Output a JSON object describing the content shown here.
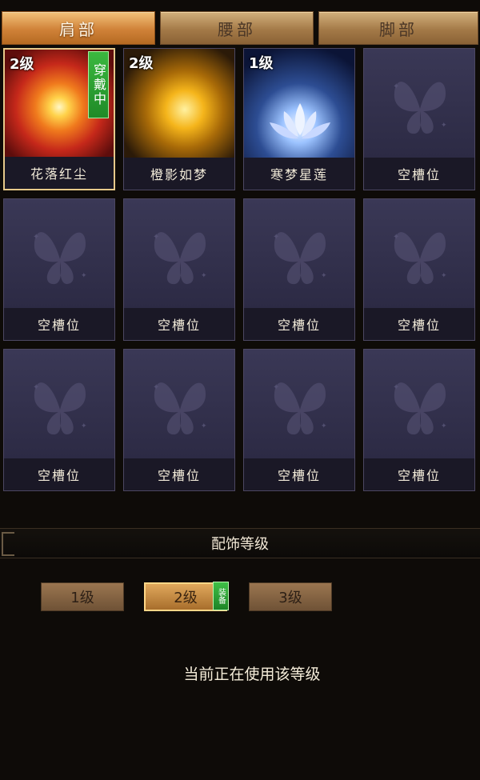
{
  "tabs": [
    {
      "label": "肩部",
      "active": true
    },
    {
      "label": "腰部",
      "active": false
    },
    {
      "label": "脚部",
      "active": false
    }
  ],
  "slots": [
    {
      "name": "花落红尘",
      "level": "2级",
      "badge": "穿戴中",
      "art": "fire",
      "selected": true
    },
    {
      "name": "橙影如梦",
      "level": "2级",
      "badge": "",
      "art": "gold",
      "selected": false
    },
    {
      "name": "寒梦星莲",
      "level": "1级",
      "badge": "",
      "art": "lotus",
      "selected": false
    },
    {
      "name": "空槽位",
      "level": "",
      "badge": "",
      "art": "empty",
      "selected": false
    },
    {
      "name": "空槽位",
      "level": "",
      "badge": "",
      "art": "empty",
      "selected": false
    },
    {
      "name": "空槽位",
      "level": "",
      "badge": "",
      "art": "empty",
      "selected": false
    },
    {
      "name": "空槽位",
      "level": "",
      "badge": "",
      "art": "empty",
      "selected": false
    },
    {
      "name": "空槽位",
      "level": "",
      "badge": "",
      "art": "empty",
      "selected": false
    },
    {
      "name": "空槽位",
      "level": "",
      "badge": "",
      "art": "empty",
      "selected": false
    },
    {
      "name": "空槽位",
      "level": "",
      "badge": "",
      "art": "empty",
      "selected": false
    },
    {
      "name": "空槽位",
      "level": "",
      "badge": "",
      "art": "empty",
      "selected": false
    },
    {
      "name": "空槽位",
      "level": "",
      "badge": "",
      "art": "empty",
      "selected": false
    }
  ],
  "level_section": {
    "title": "配饰等级",
    "levels": [
      {
        "label": "1级",
        "active": false
      },
      {
        "label": "2级",
        "active": true
      },
      {
        "label": "3级",
        "active": false
      }
    ],
    "equip_badge": "装备",
    "status": "当前正在使用该等级"
  },
  "colors": {
    "background": "#0e0b08",
    "tab_active": "#d08238",
    "slot_bg": "#24223a",
    "badge_green": "#1f8a27",
    "selected_border": "#e6c98a"
  }
}
